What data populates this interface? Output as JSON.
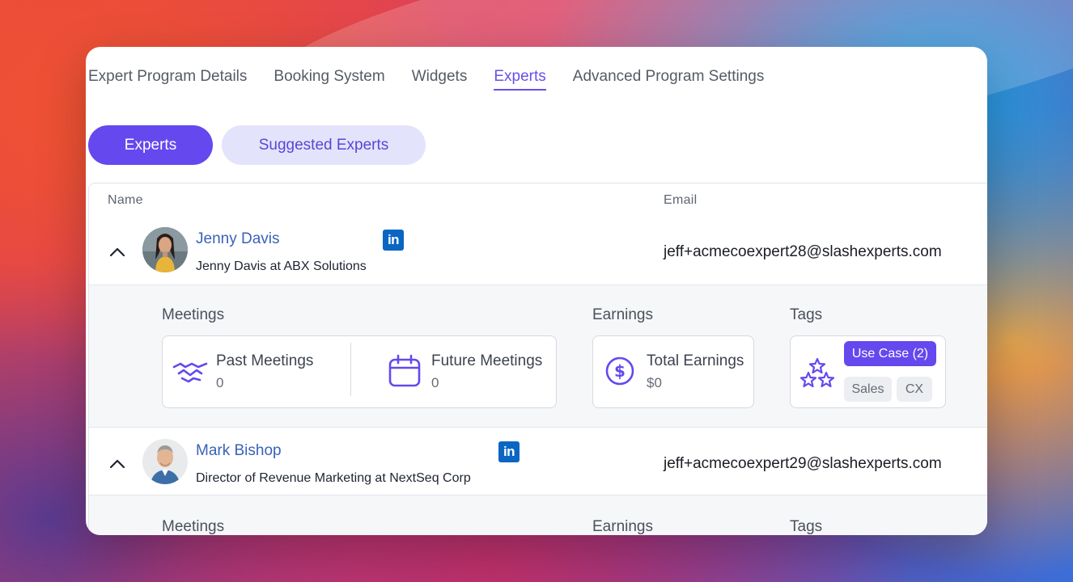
{
  "nav": {
    "tabs": [
      {
        "label": "Expert Program Details"
      },
      {
        "label": "Booking System"
      },
      {
        "label": "Widgets"
      },
      {
        "label": "Experts",
        "active": true
      },
      {
        "label": "Advanced Program Settings"
      }
    ]
  },
  "pills": {
    "primary": "Experts",
    "secondary": "Suggested Experts"
  },
  "table": {
    "headers": {
      "name": "Name",
      "email": "Email"
    },
    "rows": [
      {
        "name": "Jenny Davis",
        "subtitle": "Jenny Davis at ABX Solutions",
        "email": "jeff+acmecoexpert28@slashexperts.com",
        "linkedin": "in",
        "expanded": true,
        "details": {
          "meetings_label": "Meetings",
          "earnings_label": "Earnings",
          "tags_label": "Tags",
          "past_meetings_title": "Past Meetings",
          "past_meetings_value": "0",
          "future_meetings_title": "Future Meetings",
          "future_meetings_value": "0",
          "total_earnings_title": "Total Earnings",
          "total_earnings_value": "$0",
          "tags": [
            "Use Case (2)",
            "Sales",
            "CX"
          ]
        }
      },
      {
        "name": "Mark Bishop",
        "subtitle": "Director of Revenue Marketing at NextSeq Corp",
        "email": "jeff+acmecoexpert29@slashexperts.com",
        "linkedin": "in",
        "expanded": true,
        "details": {
          "meetings_label": "Meetings",
          "earnings_label": "Earnings",
          "tags_label": "Tags"
        }
      }
    ]
  },
  "colors": {
    "accent": "#6548ee",
    "accent_light": "#e3e4fb",
    "link": "#3a62b8",
    "linkedin": "#0a66c2"
  },
  "icons": {
    "chevron": "chevron-up-icon",
    "linkedin": "linkedin-icon",
    "past_meetings": "handshake-icon",
    "future_meetings": "calendar-icon",
    "earnings": "dollar-circle-icon",
    "tags": "stars-icon"
  }
}
